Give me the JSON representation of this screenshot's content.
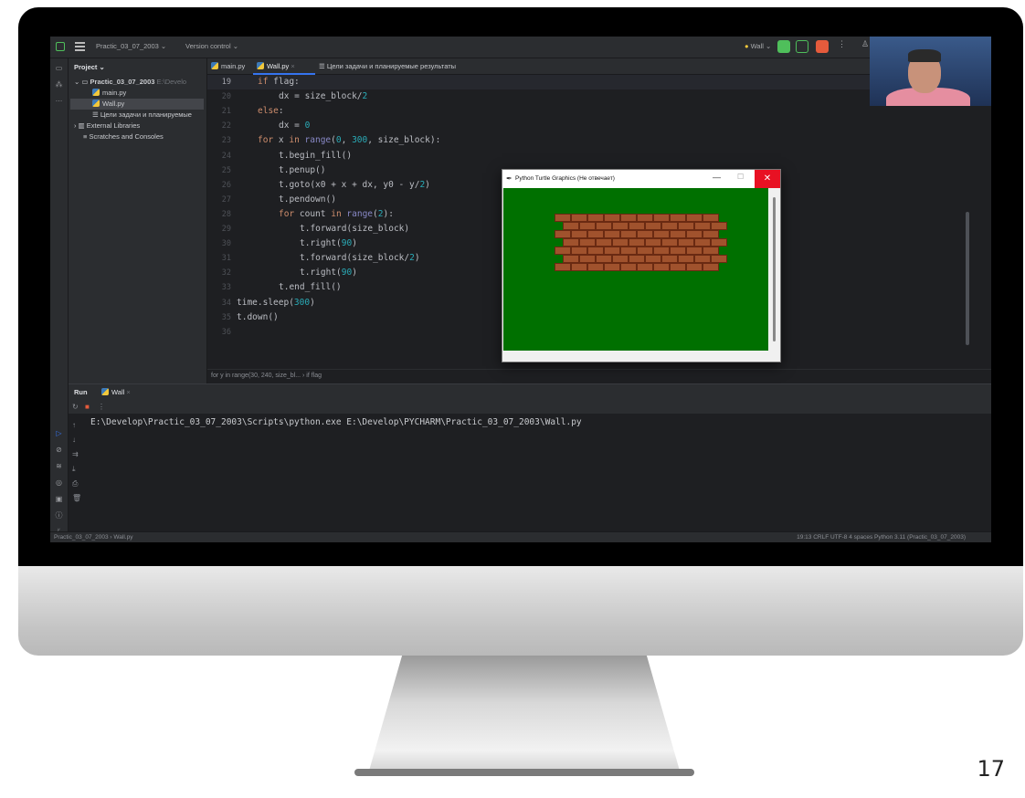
{
  "page_number": "17",
  "ide": {
    "project_name": "Practic_03_07_2003",
    "vcs_label": "Version control",
    "run_config": "Wall",
    "project_panel": {
      "header": "Project",
      "root": "Practic_03_07_2003",
      "root_path": "E:\\Develo",
      "files": [
        "main.py",
        "Wall.py",
        "Цели задачи и планируемые"
      ],
      "external_libraries": "External Libraries",
      "scratches": "Scratches and Consoles"
    },
    "tabs": [
      "main.py",
      "Wall.py",
      "Цели задачи и планируемые результаты"
    ],
    "code_lines": [
      {
        "n": "19",
        "indent": 1,
        "html": "<span class='kw'>if</span> flag:"
      },
      {
        "n": "20",
        "indent": 2,
        "html": "dx = size_block/<span class='num'>2</span>"
      },
      {
        "n": "21",
        "indent": 1,
        "html": "<span class='kw'>else</span>:"
      },
      {
        "n": "22",
        "indent": 2,
        "html": "dx = <span class='num'>0</span>"
      },
      {
        "n": "23",
        "indent": 1,
        "html": "<span class='kw'>for</span> x <span class='kw'>in</span> <span class='bi'>range</span>(<span class='num'>0</span>, <span class='num'>300</span>, size_block):"
      },
      {
        "n": "24",
        "indent": 2,
        "html": "t.begin_fill()"
      },
      {
        "n": "25",
        "indent": 2,
        "html": "t.penup()"
      },
      {
        "n": "26",
        "indent": 2,
        "html": "t.goto(x0 + x + dx, y0 - y/<span class='num'>2</span>)"
      },
      {
        "n": "27",
        "indent": 2,
        "html": "t.pendown()"
      },
      {
        "n": "28",
        "indent": 2,
        "html": "<span class='kw'>for</span> count <span class='kw'>in</span> <span class='bi'>range</span>(<span class='num'>2</span>):"
      },
      {
        "n": "29",
        "indent": 3,
        "html": "t.forward(size_block)"
      },
      {
        "n": "30",
        "indent": 3,
        "html": "t.right(<span class='num'>90</span>)"
      },
      {
        "n": "31",
        "indent": 3,
        "html": "t.forward(size_block/<span class='num'>2</span>)"
      },
      {
        "n": "32",
        "indent": 3,
        "html": "t.right(<span class='num'>90</span>)"
      },
      {
        "n": "33",
        "indent": 2,
        "html": "t.end_fill()"
      },
      {
        "n": "34",
        "indent": 0,
        "html": "time.sleep(<span class='num'>300</span>)"
      },
      {
        "n": "35",
        "indent": 0,
        "html": "t.down()"
      },
      {
        "n": "36",
        "indent": 0,
        "html": ""
      }
    ],
    "breadcrumb": "for y in range(30, 240, size_bl...  ›  if flag",
    "run": {
      "tab_label": "Run",
      "config_tab": "Wall",
      "console_line": "E:\\Develop\\Practic_03_07_2003\\Scripts\\python.exe E:\\Develop\\PYCHARM\\Practic_03_07_2003\\Wall.py"
    },
    "status": {
      "path": "Practic_03_07_2003  ›  Wall.py",
      "right": "19:13   CRLF   UTF-8   4 spaces   Python 3.11 (Practic_03_07_2003)"
    }
  },
  "turtle_window": {
    "title": "Python Turtle Graphics (Не отвечает)",
    "background_color": "#007000",
    "brick_color": "#a0522d"
  }
}
